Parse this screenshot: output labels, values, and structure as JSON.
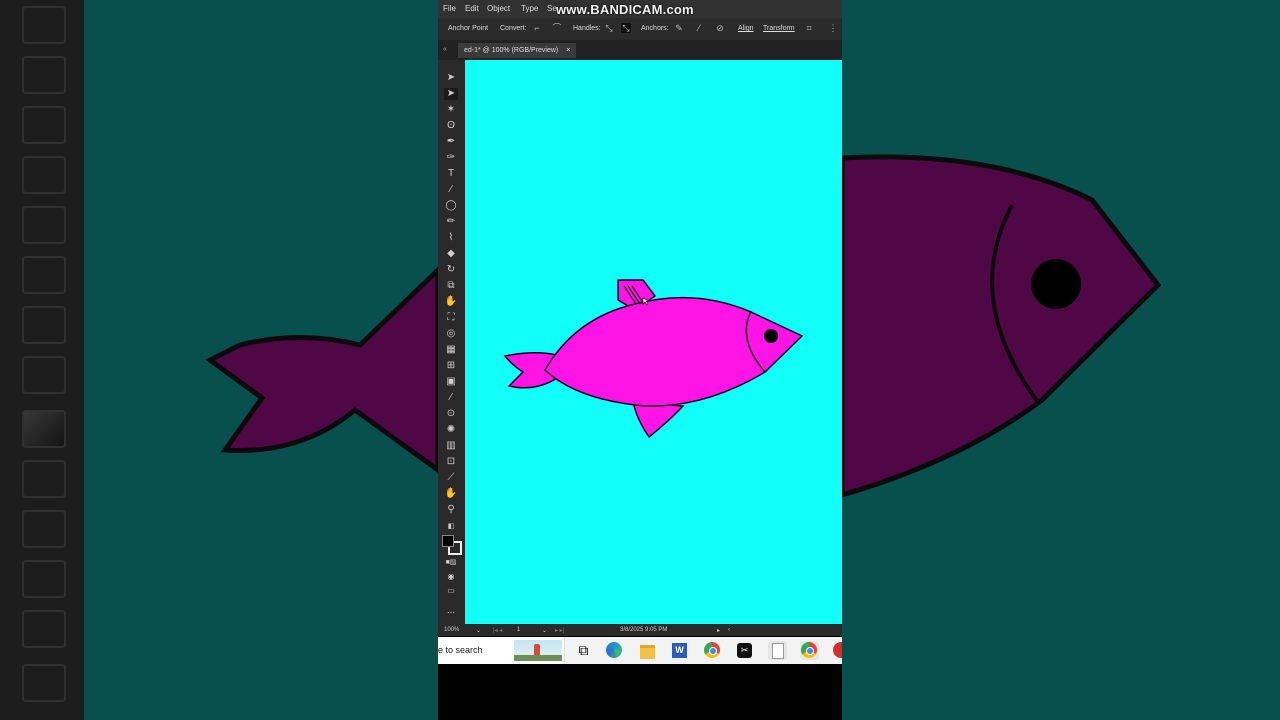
{
  "recording_watermark": "www.BANDICAM.com",
  "menu": {
    "file": "File",
    "edit": "Edit",
    "object": "Object",
    "type": "Type",
    "select_partial": "Se"
  },
  "control_bar": {
    "context": "Anchor Point",
    "convert": "Convert:",
    "handles": "Handles:",
    "anchors": "Anchors:",
    "align": "Align",
    "transform": "Transform"
  },
  "document_tab": {
    "title": "ed-1* @ 100% (RGB/Preview)",
    "close": "×"
  },
  "toolbox": {
    "tools": [
      "selection-tool",
      "direct-selection-tool",
      "magic-wand-tool",
      "lasso-tool",
      "pen-tool",
      "curvature-tool",
      "type-tool",
      "line-segment-tool",
      "ellipse-tool",
      "paintbrush-tool",
      "shaper-tool",
      "eraser-tool",
      "rotate-tool",
      "scale-tool",
      "puppet-warp-tool",
      "free-transform-tool",
      "shape-builder-tool",
      "perspective-grid-tool",
      "mesh-tool",
      "gradient-tool",
      "eyedropper-tool",
      "blend-tool",
      "symbol-sprayer-tool",
      "column-graph-tool",
      "artboard-tool",
      "slice-tool",
      "hand-tool",
      "zoom-tool"
    ],
    "more": "..."
  },
  "canvas": {
    "background_color": "#11fff8",
    "fish_body_color": "#ff14e6",
    "fish_outline_color": "#1a001a"
  },
  "background_fish_color": "#4f0845",
  "status_bar": {
    "zoom": "100%",
    "artboard_number": "1",
    "datetime": "3/8/2025  9:05 PM"
  },
  "taskbar": {
    "search_placeholder": "e to search",
    "apps": [
      "task-view",
      "edge",
      "file-explorer",
      "word",
      "chrome",
      "capcut",
      "notepad",
      "chrome",
      "bandicam"
    ]
  }
}
